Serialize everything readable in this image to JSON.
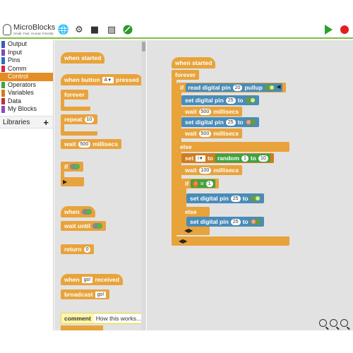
{
  "app": {
    "name": "MicroBlocks",
    "tagline": "Small, Fast, Human Friendly"
  },
  "toolbar": {
    "icons": [
      "globe-icon",
      "gear-icon",
      "file-icon",
      "graph-icon",
      "connection-icon"
    ],
    "run_icon": "play-icon",
    "stop_icon": "stop-icon"
  },
  "categories": [
    {
      "label": "Output",
      "color": "#3b5ab8"
    },
    {
      "label": "Input",
      "color": "#7a4bb8"
    },
    {
      "label": "Pins",
      "color": "#2a70c2"
    },
    {
      "label": "Comm",
      "color": "#d8283a"
    },
    {
      "label": "Control",
      "color": "#e38d24",
      "selected": true
    },
    {
      "label": "Operators",
      "color": "#3fa33f"
    },
    {
      "label": "Variables",
      "color": "#d87a1c"
    },
    {
      "label": "Data",
      "color": "#c23030"
    },
    {
      "label": "My Blocks",
      "color": "#8a4bb8"
    }
  ],
  "libraries": {
    "label": "Libraries",
    "add": "+"
  },
  "palette": {
    "when_started": "when started",
    "when_button": "when button",
    "button_value": "A",
    "pressed": "pressed",
    "forever": "forever",
    "repeat": "repeat",
    "repeat_count": "10",
    "wait": "wait",
    "wait_value": "500",
    "millisecs": "millisecs",
    "if": "if",
    "when": "when",
    "wait_until": "wait until",
    "return": "return",
    "return_value": "0",
    "when_msg": "when",
    "msg_value": "go!",
    "received": "received",
    "broadcast": "broadcast",
    "broadcast_value": "go!",
    "comment_label": "comment",
    "comment_text": "How this works..."
  },
  "script": {
    "when_started": "when started",
    "forever": "forever",
    "if": "if",
    "read_digital_pin": "read digital pin",
    "read_pin": "20",
    "pullup": "pullup",
    "set_digital_pin": "set digital pin",
    "to": "to",
    "pin_a": "25",
    "pin_b": "26",
    "wait": "wait",
    "wait_500": "500",
    "wait_100": "100",
    "millisecs": "millisecs",
    "else": "else",
    "set": "set",
    "var_i": "i",
    "random": "random",
    "rand_from": "1",
    "rand_to": "10",
    "eq_left": "i",
    "eq_op": "=",
    "eq_right": "1",
    "pin_c": "25"
  }
}
